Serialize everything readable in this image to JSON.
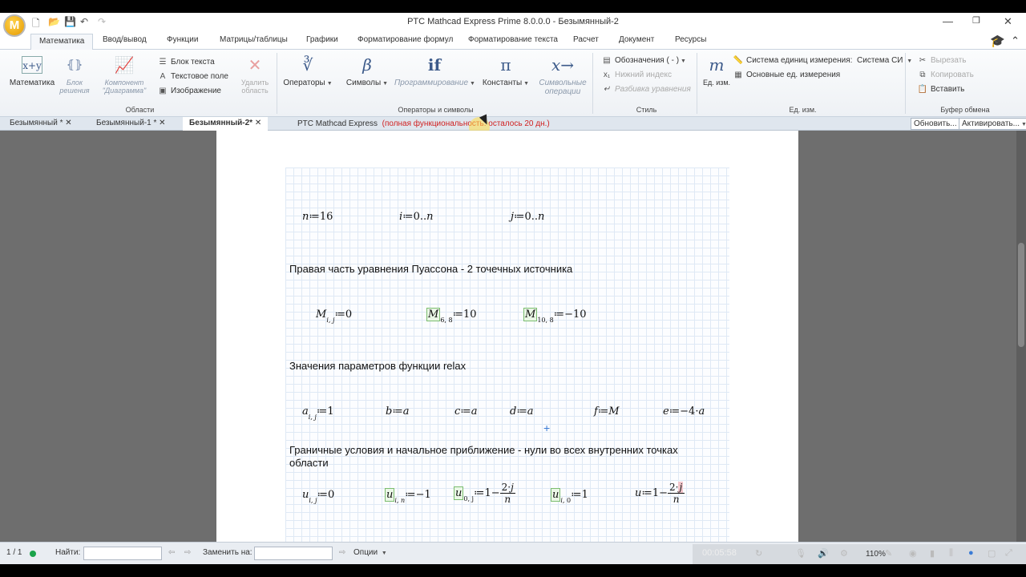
{
  "window": {
    "title": "PTC Mathcad Express Prime 8.0.0.0 - Безымянный-2",
    "logo_letter": "M"
  },
  "ribbon_tabs": [
    "Математика",
    "Ввод/вывод",
    "Функции",
    "Матрицы/таблицы",
    "Графики",
    "Форматирование формул",
    "Форматирование текста",
    "Расчет",
    "Документ",
    "Ресурсы"
  ],
  "ribbon": {
    "regions": {
      "label": "Области",
      "math": "Математика",
      "solve_block": "Блок решения",
      "component": "Компонент \"Диаграмма\"",
      "text_block": "Блок текста",
      "text_field": "Текстовое поле",
      "image": "Изображение",
      "delete_region": "Удалить область"
    },
    "operators": {
      "label": "Операторы и символы",
      "operators": "Операторы",
      "symbols": "Символы",
      "programming": "Программирование",
      "constants": "Константы",
      "symbolic_ops": "Символьные операции"
    },
    "style": {
      "label": "Стиль",
      "labels": "Обозначения  ( - )",
      "subscript": "Нижний индекс",
      "split_eq": "Разбивка уравнения"
    },
    "units": {
      "label": "Ед. изм.",
      "units_btn": "Ед. изм.",
      "system_label": "Система единиц измерения:",
      "system_value": "Система СИ",
      "base_units": "Основные ед. измерения"
    },
    "clipboard": {
      "label": "Буфер обмена",
      "cut": "Вырезать",
      "copy": "Копировать",
      "paste": "Вставить"
    }
  },
  "doc_tabs": [
    {
      "label": "Безымянный  *"
    },
    {
      "label": "Безымянный-1  *"
    },
    {
      "label": "Безымянный-2*"
    }
  ],
  "notice": {
    "product": "PTC Mathcad Express",
    "trial": "(полная функциональность: осталось 20 дн.)",
    "update_btn": "Обновить...",
    "activate_btn": "Активировать..."
  },
  "worksheet": {
    "text1": "Правая часть уравнения Пуассона - 2 точечных источника",
    "text2": "Значения параметров функции relax",
    "text3": "Граничные условия и начальное приближение - нули во  всех внутренних точках области"
  },
  "statusbar": {
    "page": "1 / 1",
    "find_label": "Найти:",
    "replace_label": "Заменить на:",
    "options": "Опции",
    "zoom": "110%"
  },
  "player": {
    "time": "00:05:58"
  }
}
